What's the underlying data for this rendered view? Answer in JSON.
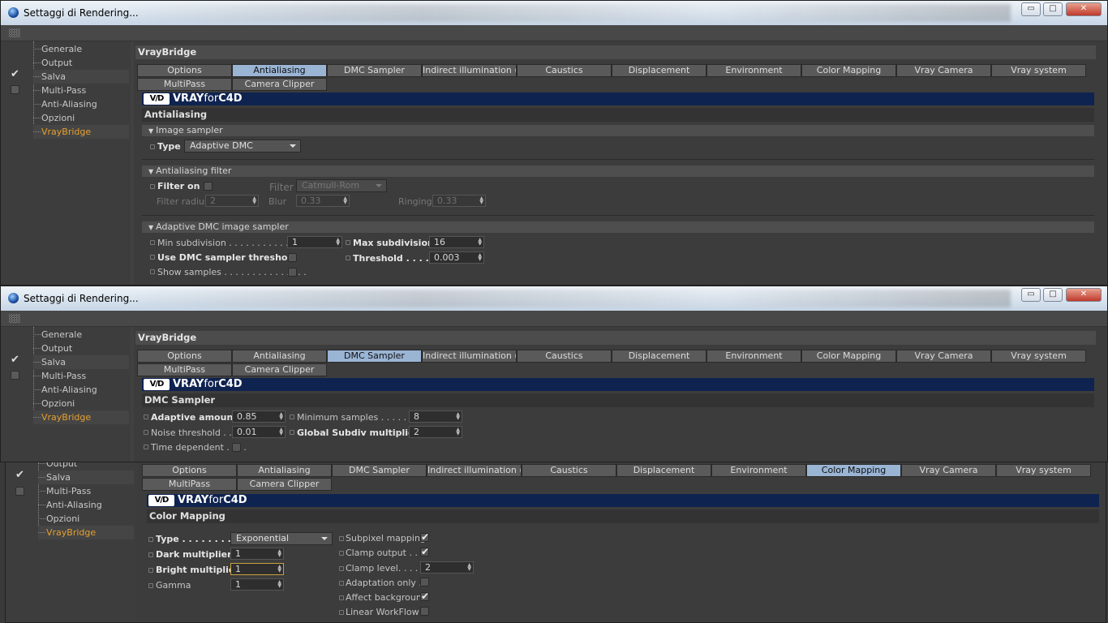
{
  "window_title": "Settaggi di Rendering...",
  "window_buttons": {
    "minimize": "▭",
    "maximize": "□",
    "close": "✕"
  },
  "tree": [
    "Generale",
    "Output",
    "Salva",
    "Multi-Pass",
    "Anti-Aliasing",
    "Opzioni",
    "VrayBridge"
  ],
  "tree3": [
    "Output",
    "Salva",
    "Multi-Pass",
    "Anti-Aliasing",
    "Opzioni",
    "VrayBridge"
  ],
  "check_mark": "✔",
  "section_title": "VrayBridge",
  "tabs": [
    "Options",
    "Antialiasing",
    "DMC Sampler",
    "Indirect illumination (GI)",
    "Caustics",
    "Displacement",
    "Environment",
    "Color Mapping",
    "Vray Camera",
    "Vray system",
    "MultiPass",
    "Camera Clipper"
  ],
  "banner": {
    "logo": "V/D",
    "text_a": "VRAY",
    "text_b": "for",
    "text_c": "C4D"
  },
  "w1": {
    "page_title": "Antialiasing",
    "image_sampler": {
      "header": "Image sampler",
      "type_label": "Type",
      "type_value": "Adaptive DMC"
    },
    "aa_filter": {
      "header": "Antialiasing filter",
      "filter_on": "Filter on",
      "filter_label": "Filter",
      "filter_value": "Catmull-Rom",
      "radius_label": "Filter radius",
      "radius_value": "2",
      "blur_label": "Blur",
      "blur_value": "0.33",
      "ringing_label": "Ringing",
      "ringing_value": "0.33"
    },
    "adaptive": {
      "header": "Adaptive DMC image sampler",
      "min_label": "Min subdivision . . . . . . . . . . . . . .",
      "min_value": "1",
      "max_label": "Max subdivision",
      "max_value": "16",
      "use_label": "Use DMC sampler threshold",
      "thr_label": "Threshold . . . . .",
      "thr_value": "0.003",
      "show_label": "Show samples . . . . . . . . . . . . . . ."
    }
  },
  "w2": {
    "page_title": "DMC Sampler",
    "adaptive_label": "Adaptive amount",
    "adaptive_value": "0.85",
    "minsamp_label": "Minimum samples . . . . . . . .",
    "minsamp_value": "8",
    "noise_label": "Noise threshold . . .",
    "noise_value": "0.01",
    "global_label": "Global Subdiv multiplier",
    "global_value": "2",
    "timedep_label": "Time dependent . . . ."
  },
  "w3": {
    "page_title": "Color Mapping",
    "type_label": "Type . . . . . . . . . .",
    "type_value": "Exponential",
    "dark_label": "Dark multiplier",
    "dark_value": "1",
    "bright_label": "Bright multiplier",
    "bright_value": "1",
    "gamma_label": "Gamma",
    "gamma_value": "1",
    "subpixel_label": "Subpixel mapping",
    "clampout_label": "Clamp output . . . .",
    "clamplevel_label": "Clamp level. . . . . .",
    "clamplevel_value": "2",
    "adaptonly_label": "Adaptation only . .",
    "affectbg_label": "Affect background",
    "linear_label": "Linear WorkFlow"
  }
}
